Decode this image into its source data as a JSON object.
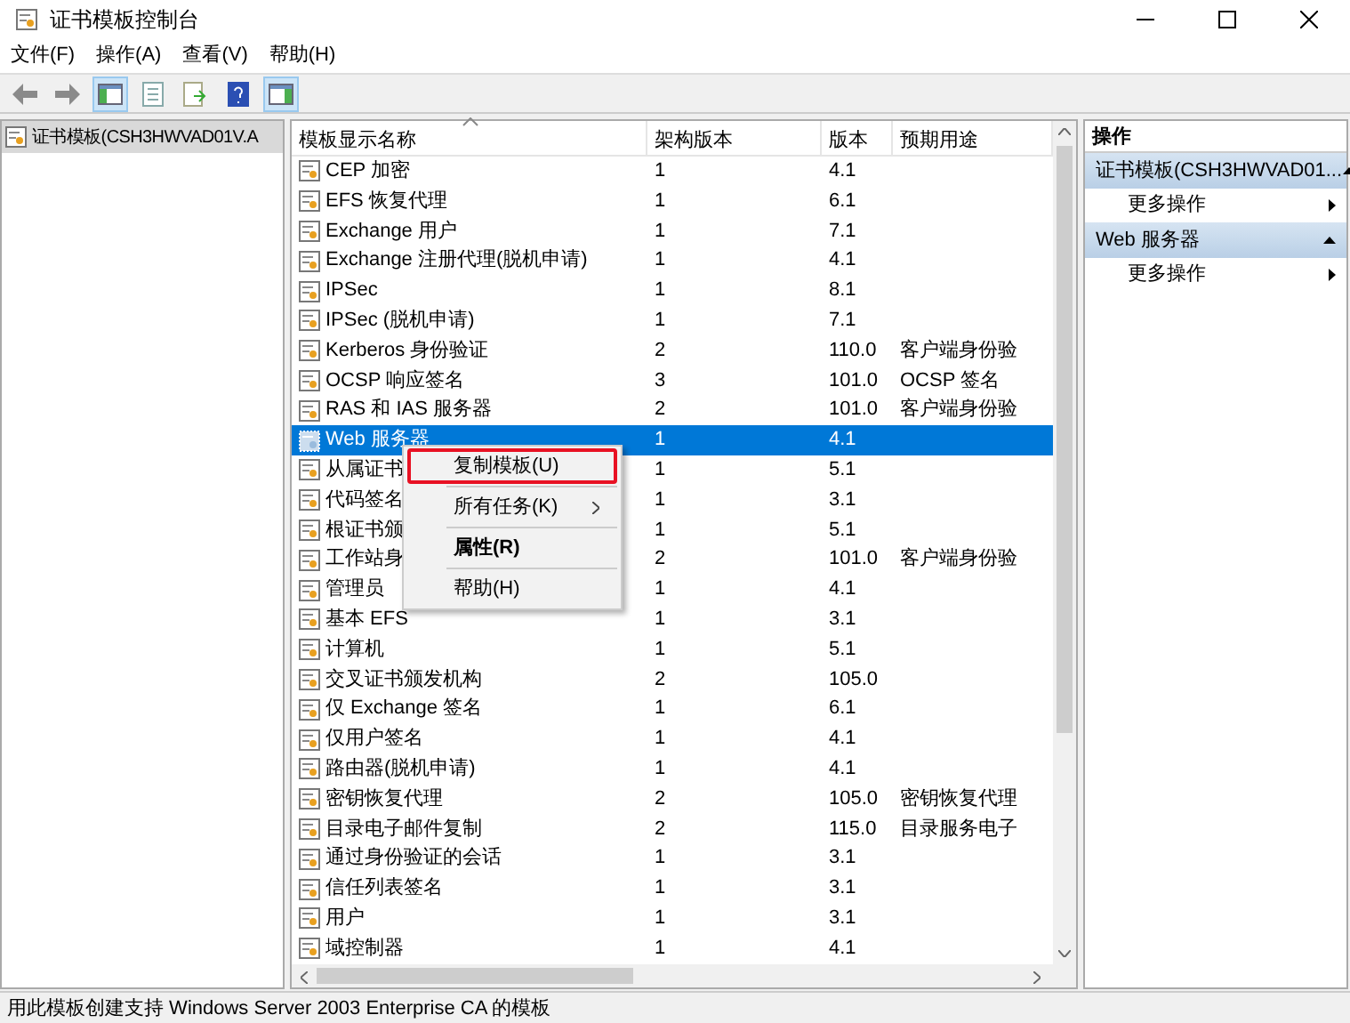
{
  "window": {
    "title": "证书模板控制台"
  },
  "menu": [
    "文件(F)",
    "操作(A)",
    "查看(V)",
    "帮助(H)"
  ],
  "tree": [
    {
      "label": "证书模板(CSH3HWVAD01V.A",
      "selected": true
    }
  ],
  "table": {
    "columns": [
      "模板显示名称",
      "架构版本",
      "版本",
      "预期用途"
    ],
    "rows": [
      {
        "name": "CEP 加密",
        "schema": "1",
        "version": "4.1",
        "selected": false
      },
      {
        "name": "EFS 恢复代理",
        "schema": "1",
        "version": "6.1",
        "selected": false
      },
      {
        "name": "Exchange 用户",
        "schema": "1",
        "version": "7.1",
        "selected": false
      },
      {
        "name": "Exchange 注册代理(脱机申请)",
        "schema": "1",
        "version": "4.1",
        "selected": false
      },
      {
        "name": "IPSec",
        "schema": "1",
        "version": "8.1",
        "selected": false
      },
      {
        "name": "IPSec (脱机申请)",
        "schema": "1",
        "version": "7.1",
        "selected": false
      },
      {
        "name": "Kerberos 身份验证",
        "schema": "2",
        "version": "110.0",
        "purpose": "客户端身份验",
        "selected": false
      },
      {
        "name": "OCSP 响应签名",
        "schema": "3",
        "version": "101.0",
        "purpose": "OCSP 签名",
        "selected": false
      },
      {
        "name": "RAS 和 IAS 服务器",
        "schema": "2",
        "version": "101.0",
        "purpose": "客户端身份验",
        "selected": false
      },
      {
        "name": "Web 服务器",
        "schema": "1",
        "version": "4.1",
        "selected": true
      },
      {
        "name": "从属证书",
        "schema": "1",
        "version": "5.1",
        "selected": false
      },
      {
        "name": "代码签名",
        "schema": "1",
        "version": "3.1",
        "selected": false
      },
      {
        "name": "根证书颁",
        "schema": "1",
        "version": "5.1",
        "selected": false
      },
      {
        "name": "工作站身",
        "schema": "2",
        "version": "101.0",
        "purpose": "客户端身份验",
        "selected": false
      },
      {
        "name": "管理员",
        "schema": "1",
        "version": "4.1",
        "selected": false
      },
      {
        "name": "基本 EFS",
        "schema": "1",
        "version": "3.1",
        "selected": false
      },
      {
        "name": "计算机",
        "schema": "1",
        "version": "5.1",
        "selected": false
      },
      {
        "name": "交叉证书颁发机构",
        "schema": "2",
        "version": "105.0",
        "selected": false
      },
      {
        "name": "仅 Exchange 签名",
        "schema": "1",
        "version": "6.1",
        "selected": false
      },
      {
        "name": "仅用户签名",
        "schema": "1",
        "version": "4.1",
        "selected": false
      },
      {
        "name": "路由器(脱机申请)",
        "schema": "1",
        "version": "4.1",
        "selected": false
      },
      {
        "name": "密钥恢复代理",
        "schema": "2",
        "version": "105.0",
        "purpose": "密钥恢复代理",
        "selected": false
      },
      {
        "name": "目录电子邮件复制",
        "schema": "2",
        "version": "115.0",
        "purpose": "目录服务电子",
        "selected": false
      },
      {
        "name": "通过身份验证的会话",
        "schema": "1",
        "version": "3.1",
        "selected": false
      },
      {
        "name": "信任列表签名",
        "schema": "1",
        "version": "3.1",
        "selected": false
      },
      {
        "name": "用户",
        "schema": "1",
        "version": "3.1",
        "selected": false
      },
      {
        "name": "域控制器",
        "schema": "1",
        "version": "4.1",
        "selected": false
      }
    ]
  },
  "context_menu": [
    {
      "label": "复制模板(U)",
      "highlighted": true,
      "submenu": false,
      "bold": false
    },
    {
      "label": "所有任务(K)",
      "highlighted": false,
      "submenu": true,
      "bold": false
    },
    {
      "label": "属性(R)",
      "highlighted": false,
      "submenu": false,
      "bold": true
    },
    {
      "label": "帮助(H)",
      "highlighted": false,
      "submenu": false,
      "bold": false
    }
  ],
  "actions": {
    "title": "操作",
    "groups": [
      {
        "header": "证书模板(CSH3HWVAD01...",
        "item": "更多操作"
      },
      {
        "header": "Web 服务器",
        "item": "更多操作"
      }
    ]
  },
  "status_bar": "用此模板创建支持 Windows Server 2003 Enterprise CA 的模板"
}
